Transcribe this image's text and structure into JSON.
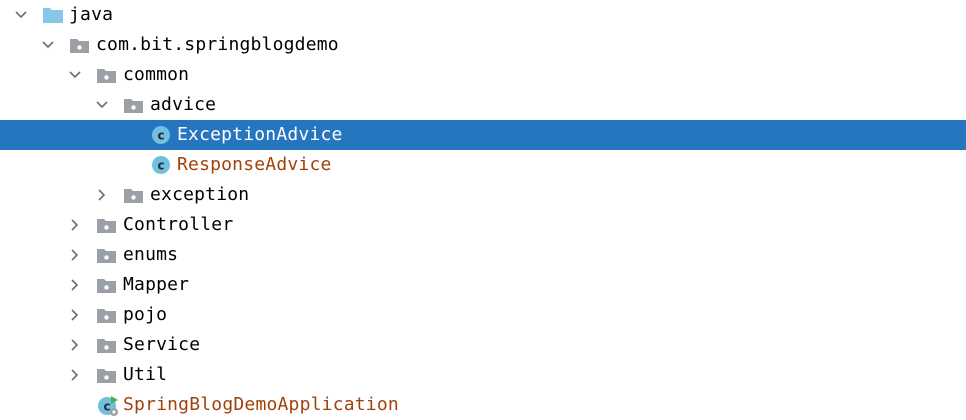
{
  "colors": {
    "selection_bg": "#2675bf",
    "class_text": "#a1410b",
    "folder_gray": "#9aa0a6",
    "source_folder_blue": "#87c7e8",
    "class_icon_fill": "#6fc1df",
    "class_icon_letter": "#2b2b2b"
  },
  "tree": {
    "items": [
      {
        "label": "java",
        "icon": "source-folder-icon",
        "arrow": "expanded"
      },
      {
        "label": "com.bit.springblogdemo",
        "icon": "package-icon",
        "arrow": "expanded"
      },
      {
        "label": "common",
        "icon": "package-icon",
        "arrow": "expanded"
      },
      {
        "label": "advice",
        "icon": "package-icon",
        "arrow": "expanded"
      },
      {
        "label": "ExceptionAdvice",
        "icon": "class-icon",
        "arrow": "none",
        "selected": true
      },
      {
        "label": "ResponseAdvice",
        "icon": "class-icon",
        "arrow": "none"
      },
      {
        "label": "exception",
        "icon": "package-icon",
        "arrow": "collapsed"
      },
      {
        "label": "Controller",
        "icon": "package-icon",
        "arrow": "collapsed"
      },
      {
        "label": "enums",
        "icon": "package-icon",
        "arrow": "collapsed"
      },
      {
        "label": "Mapper",
        "icon": "package-icon",
        "arrow": "collapsed"
      },
      {
        "label": "pojo",
        "icon": "package-icon",
        "arrow": "collapsed"
      },
      {
        "label": "Service",
        "icon": "package-icon",
        "arrow": "collapsed"
      },
      {
        "label": "Util",
        "icon": "package-icon",
        "arrow": "collapsed"
      },
      {
        "label": "SpringBlogDemoApplication",
        "icon": "spring-boot-class-icon",
        "arrow": "none"
      }
    ]
  }
}
